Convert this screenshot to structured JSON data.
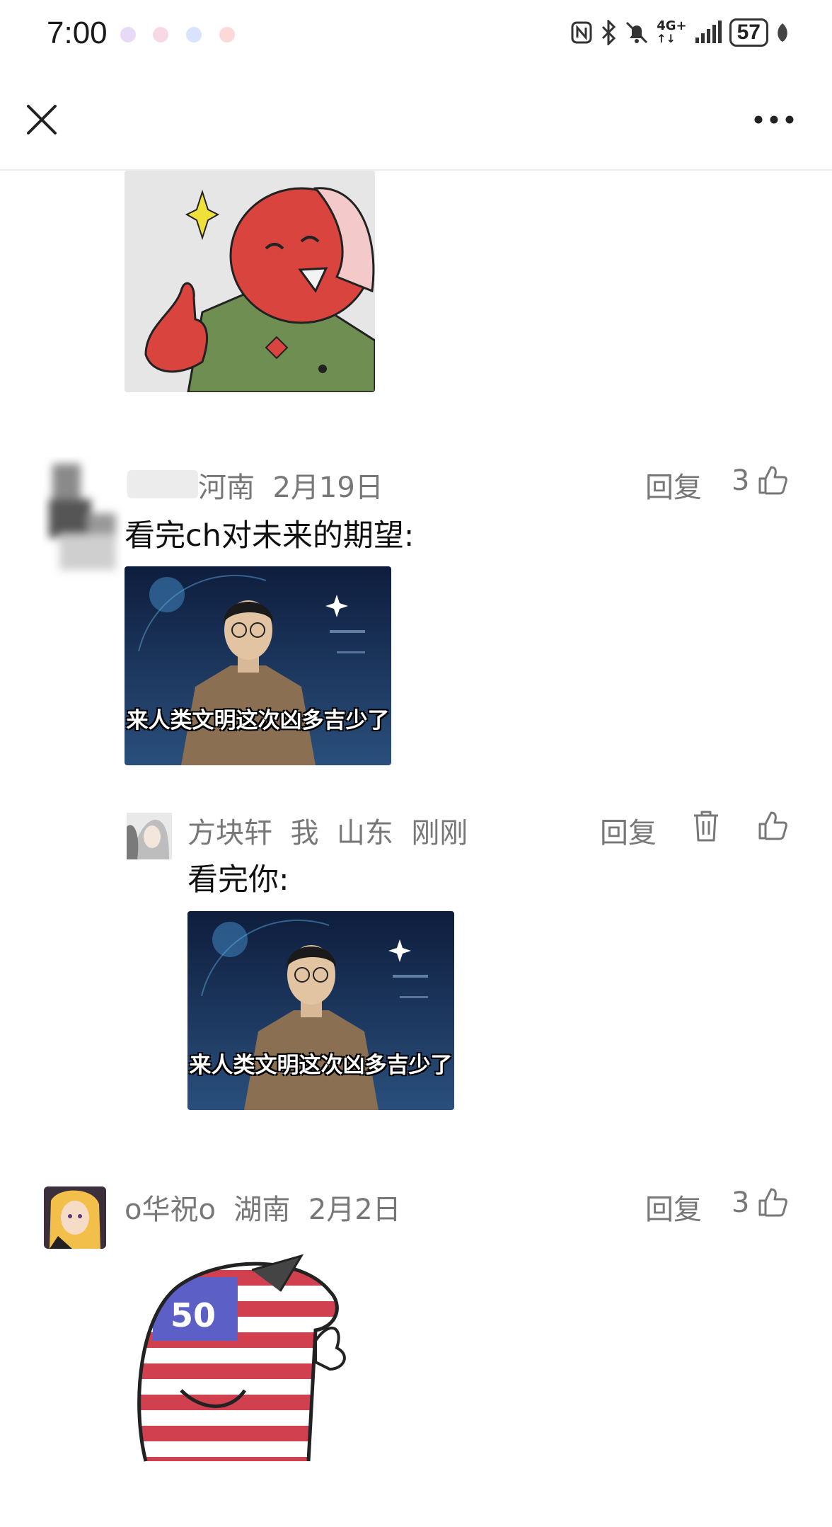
{
  "status_bar": {
    "time": "7:00",
    "network_label": "4G+",
    "battery": "57",
    "notification_icons": [
      "app-notification-icon",
      "app-notification-icon",
      "app-notification-icon",
      "app-notification-icon"
    ]
  },
  "header": {
    "close_icon": "close-icon",
    "more_icon": "more-icon"
  },
  "comments": [
    {
      "username": "",
      "location": "河南",
      "date": "2月19日",
      "reply_label": "回复",
      "likes": "3",
      "text": "看完ch对未来的期望:",
      "image_caption": "来人类文明这次凶多吉少了",
      "replies": [
        {
          "username": "方块轩",
          "me_badge": "我",
          "location": "山东",
          "date": "刚刚",
          "reply_label": "回复",
          "text": "看完你:",
          "image_caption": "来人类文明这次凶多吉少了"
        }
      ]
    },
    {
      "username": "o华祝o",
      "location": "湖南",
      "date": "2月2日",
      "reply_label": "回复",
      "likes": "3",
      "image_caption": "50"
    }
  ],
  "colors": {
    "meta_gray": "#777777",
    "divider": "#ececec"
  }
}
